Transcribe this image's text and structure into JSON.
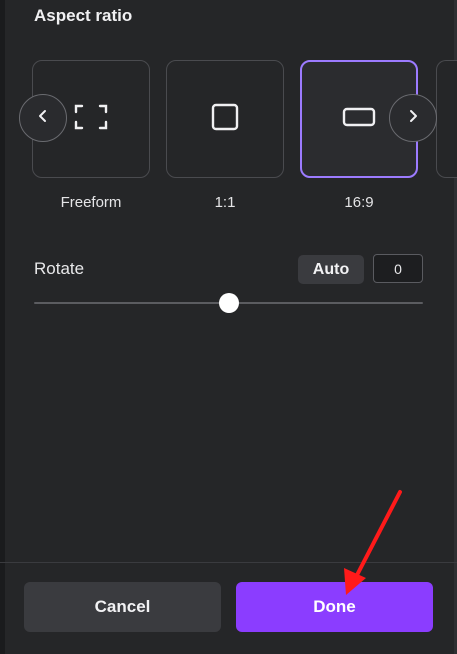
{
  "panel": {
    "section_title": "Aspect ratio"
  },
  "aspect_options": [
    {
      "label": "Freeform",
      "icon": "freeform-crop-icon",
      "selected": false
    },
    {
      "label": "1:1",
      "icon": "square-icon",
      "selected": false
    },
    {
      "label": "16:9",
      "icon": "wide-rectangle-icon",
      "selected": true
    }
  ],
  "carousel": {
    "prev_icon": "chevron-left-icon",
    "next_icon": "chevron-right-icon"
  },
  "rotate": {
    "label": "Rotate",
    "auto_label": "Auto",
    "value": "0",
    "slider_fraction": 0.5
  },
  "footer": {
    "cancel_label": "Cancel",
    "done_label": "Done"
  },
  "colors": {
    "accent": "#8b3dff",
    "selected_border": "#9c7bff",
    "annotation_arrow": "#ff1a1a"
  }
}
